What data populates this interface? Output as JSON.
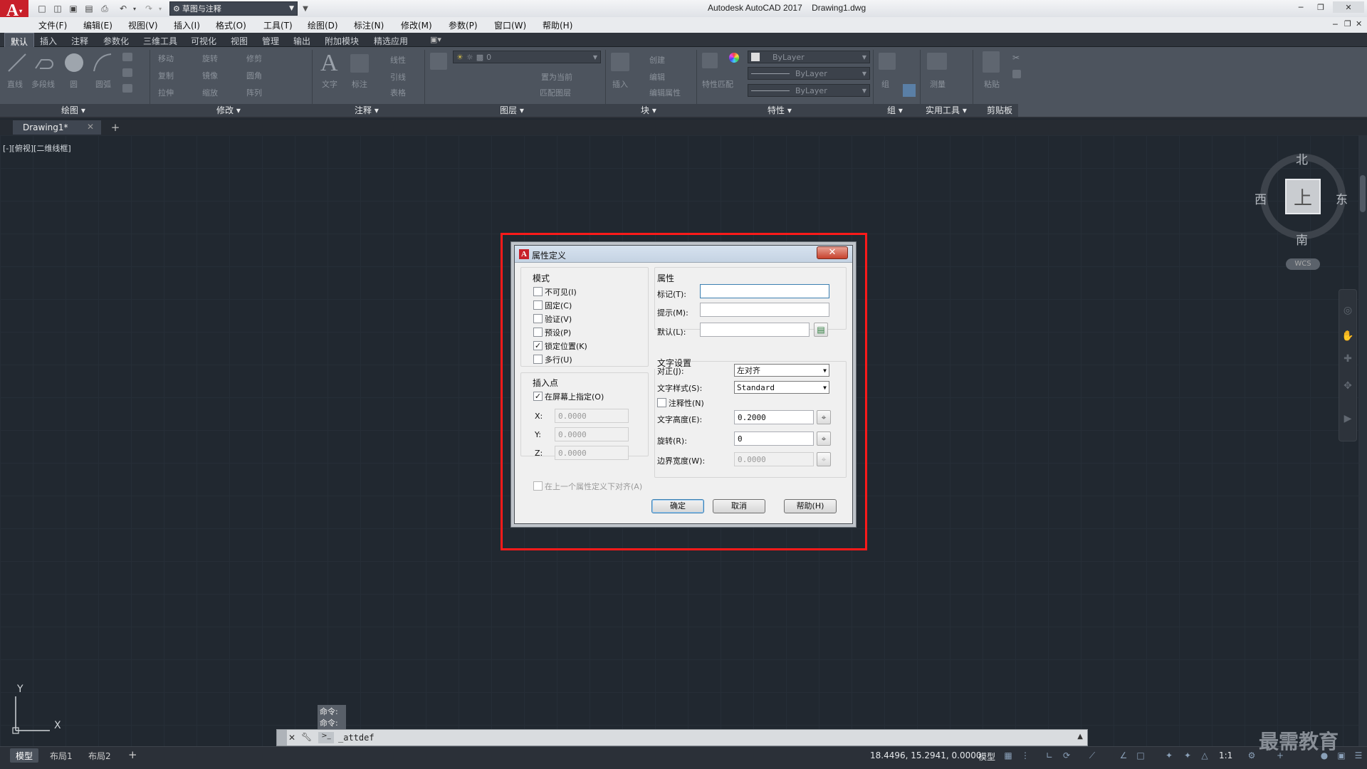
{
  "app": {
    "title": "Autodesk AutoCAD 2017",
    "filename": "Drawing1.dwg",
    "logo_letter": "A",
    "workspace": "草图与注释"
  },
  "menu": [
    "文件(F)",
    "编辑(E)",
    "视图(V)",
    "插入(I)",
    "格式(O)",
    "工具(T)",
    "绘图(D)",
    "标注(N)",
    "修改(M)",
    "参数(P)",
    "窗口(W)",
    "帮助(H)"
  ],
  "ribbon_tabs": [
    "默认",
    "插入",
    "注释",
    "参数化",
    "三维工具",
    "可视化",
    "视图",
    "管理",
    "输出",
    "附加模块",
    "精选应用"
  ],
  "ribbon": {
    "draw_tools": [
      "直线",
      "多段线",
      "圆",
      "圆弧"
    ],
    "modify_tools": [
      "移动",
      "旋转",
      "修剪",
      "复制",
      "镜像",
      "圆角",
      "拉伸",
      "缩放",
      "阵列"
    ],
    "annotation_tools": [
      "文字",
      "标注",
      "线性",
      "引线",
      "表格"
    ],
    "layer_tools": [
      "图层特性",
      "置为当前",
      "匹配图层"
    ],
    "layer_current": "0",
    "block_tools": [
      "插入",
      "创建",
      "编辑",
      "编辑属性"
    ],
    "property_tools": [
      "特性匹配"
    ],
    "bylayer_color": "ByLayer",
    "bylayer_linetype": "ByLayer",
    "bylayer_lineweight": "ByLayer",
    "group_tools": [
      "组"
    ],
    "utility_tools": [
      "测量"
    ],
    "clipboard_tools": [
      "粘贴"
    ],
    "panels": [
      "绘图",
      "修改",
      "注释",
      "图层",
      "块",
      "特性",
      "组",
      "实用工具",
      "剪贴板"
    ]
  },
  "doc_tab": "Drawing1*",
  "view_label": "[-][俯视][二维线框]",
  "viewcube": {
    "top": "上",
    "north": "北",
    "south": "南",
    "east": "东",
    "west": "西",
    "wcs": "WCS"
  },
  "ucs": {
    "x": "X",
    "y": "Y"
  },
  "dialog": {
    "title": "属性定义",
    "mode": {
      "title": "模式",
      "options": [
        {
          "label": "不可见(I)",
          "checked": false
        },
        {
          "label": "固定(C)",
          "checked": false
        },
        {
          "label": "验证(V)",
          "checked": false
        },
        {
          "label": "预设(P)",
          "checked": false
        },
        {
          "label": "锁定位置(K)",
          "checked": true
        },
        {
          "label": "多行(U)",
          "checked": false
        }
      ]
    },
    "insertion": {
      "title": "插入点",
      "on_screen": {
        "label": "在屏幕上指定(O)",
        "checked": true
      },
      "x_label": "X:",
      "x_value": "0.0000",
      "y_label": "Y:",
      "y_value": "0.0000",
      "z_label": "Z:",
      "z_value": "0.0000"
    },
    "attribute": {
      "title": "属性",
      "tag_label": "标记(T):",
      "tag_value": "",
      "prompt_label": "提示(M):",
      "prompt_value": "",
      "default_label": "默认(L):",
      "default_value": ""
    },
    "text": {
      "title": "文字设置",
      "justify_label": "对正(J):",
      "justify_value": "左对齐",
      "style_label": "文字样式(S):",
      "style_value": "Standard",
      "annotative_label": "注释性(N)",
      "annotative_checked": false,
      "height_label": "文字高度(E):",
      "height_value": "0.2000",
      "rotation_label": "旋转(R):",
      "rotation_value": "0",
      "boundary_label": "边界宽度(W):",
      "boundary_value": "0.0000"
    },
    "align_below": {
      "label": "在上一个属性定义下对齐(A)",
      "checked": false
    },
    "buttons": {
      "ok": "确定",
      "cancel": "取消",
      "help": "帮助(H)"
    }
  },
  "command": {
    "history": [
      "命令:",
      "命令:"
    ],
    "input": "_attdef"
  },
  "layout_tabs": [
    "模型",
    "布局1",
    "布局2"
  ],
  "status": {
    "coords": "18.4496, 15.2941, 0.0000",
    "model": "模型",
    "scale": "1:1"
  },
  "watermark": "最需教育",
  "colors": {
    "highlight": "#ff1a1a",
    "canvas": "#212830",
    "autodesk_red": "#c8202a"
  }
}
